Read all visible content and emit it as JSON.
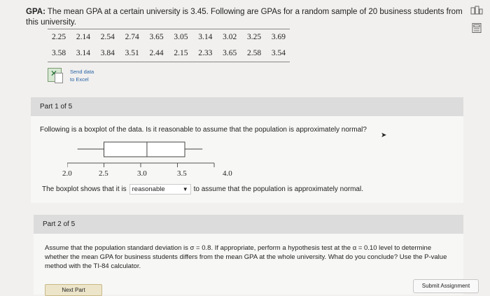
{
  "question": {
    "label": "GPA:",
    "text": "The mean GPA at a certain university is 3.45. Following are GPAs for a random sample of 20 business students from this university."
  },
  "data_rows": [
    [
      "2.25",
      "2.14",
      "2.54",
      "2.74",
      "3.65",
      "3.05",
      "3.14",
      "3.02",
      "3.25",
      "3.69"
    ],
    [
      "3.58",
      "3.14",
      "3.84",
      "3.51",
      "2.44",
      "2.15",
      "2.33",
      "3.65",
      "2.58",
      "3.54"
    ]
  ],
  "send_excel": {
    "line1": "Send data",
    "line2": "to Excel"
  },
  "part1": {
    "header": "Part 1 of 5",
    "question": "Following is a boxplot of the data. Is it reasonable to assume that the population is approximately normal?",
    "axis_ticks": [
      "2.0",
      "2.5",
      "3.0",
      "3.5",
      "4.0"
    ],
    "answer_prefix": "The boxplot shows that it is",
    "dropdown_value": "reasonable",
    "answer_suffix": "to assume that the population is approximately normal."
  },
  "boxplot": {
    "min": 2.14,
    "q1": 2.5,
    "median": 3.085,
    "q3": 3.6,
    "max": 3.84,
    "axis_min": 2.0,
    "axis_max": 4.0
  },
  "part2": {
    "header": "Part 2 of 5",
    "question": "Assume that the population standard deviation is σ = 0.8. If appropriate, perform a hypothesis test at the α = 0.10 level to determine whether the mean GPA for business students differs from the mean GPA at the whole university. What do you conclude? Use the P-value method with the TI-84 calculator."
  },
  "buttons": {
    "next": "Next Part",
    "submit": "Submit Assignment"
  },
  "colors": {
    "part_header_bg": "#dcdcdc",
    "link": "#2a63a6",
    "next_bg": "#ece5c9"
  }
}
